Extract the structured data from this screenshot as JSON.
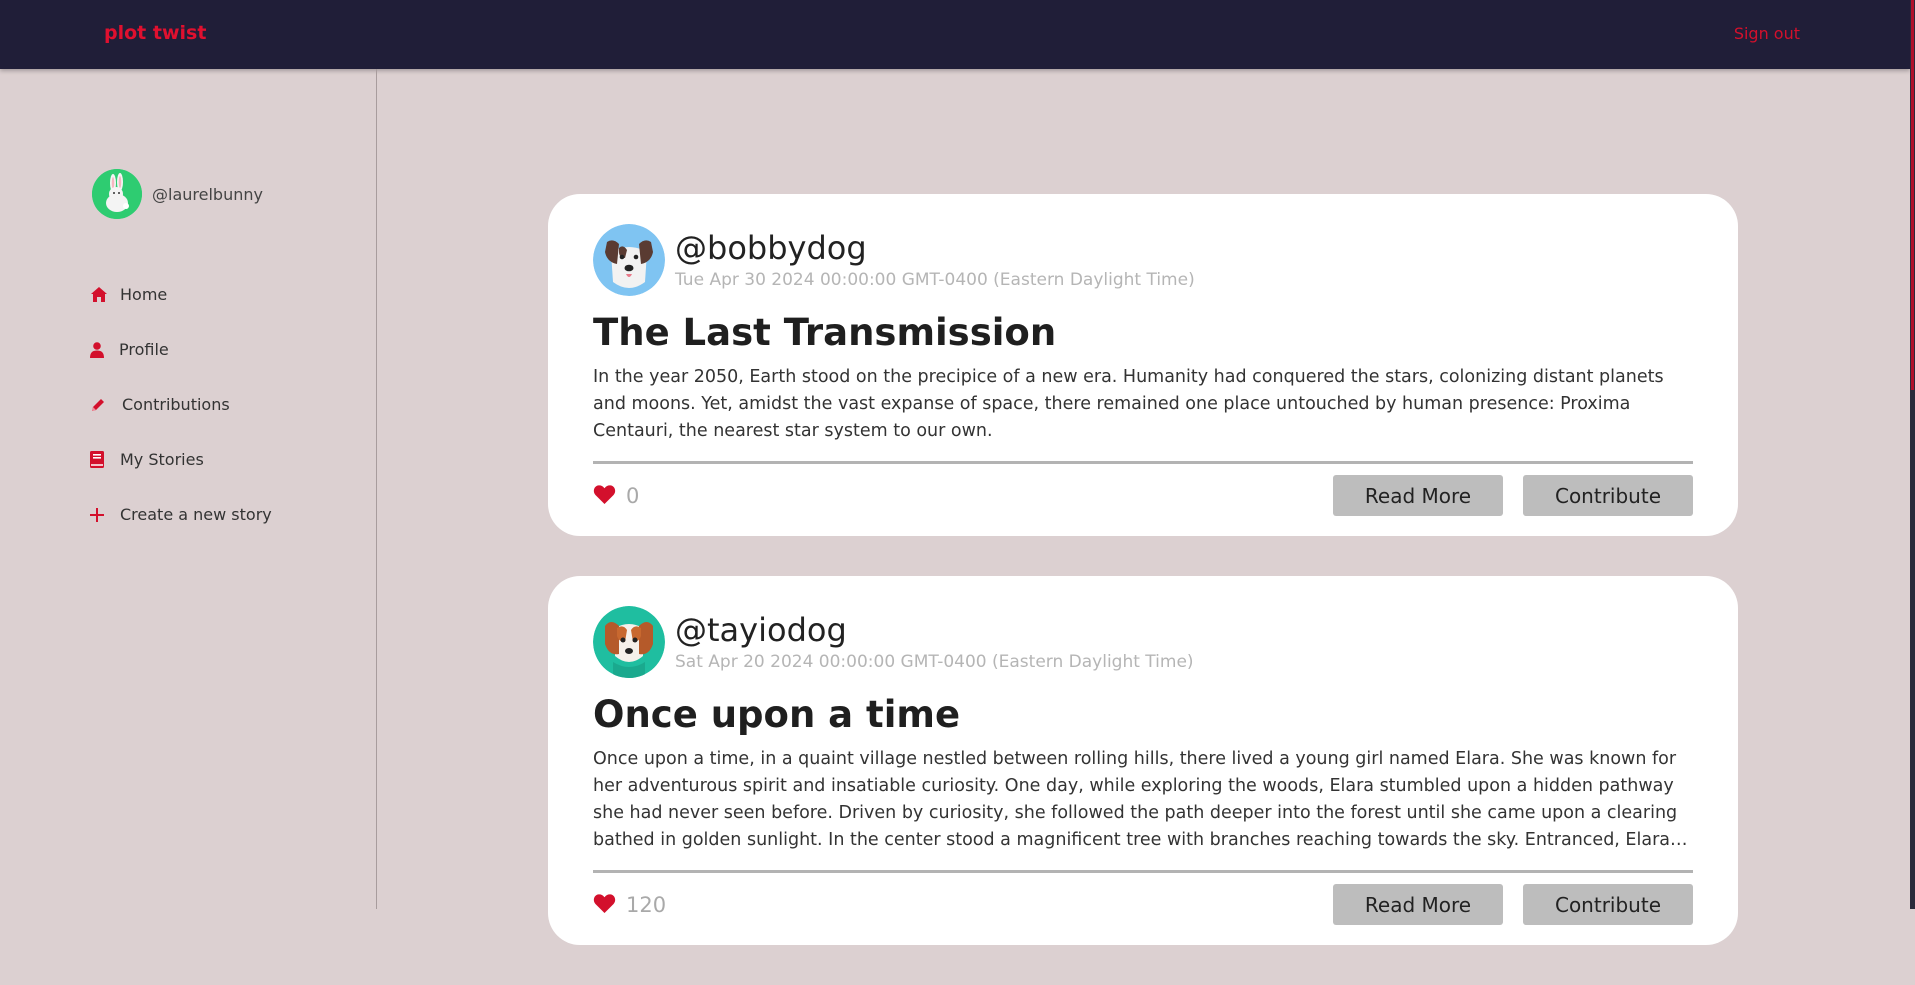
{
  "header": {
    "brand": "plot twist",
    "signout_label": "Sign out"
  },
  "sidebar": {
    "username": "@laurelbunny",
    "items": [
      {
        "label": "Home",
        "icon": "home-icon"
      },
      {
        "label": "Profile",
        "icon": "person-icon"
      },
      {
        "label": "Contributions",
        "icon": "pencil-icon"
      },
      {
        "label": "My Stories",
        "icon": "book-icon"
      },
      {
        "label": "Create a new story",
        "icon": "plus-icon"
      }
    ]
  },
  "stories": [
    {
      "author": "@bobbydog",
      "date": "Tue Apr 30 2024 00:00:00 GMT-0400 (Eastern Daylight Time)",
      "title": "The Last Transmission",
      "excerpt": "In the year 2050, Earth stood on the precipice of a new era. Humanity had conquered the stars, colonizing distant planets and moons. Yet, amidst the vast expanse of space, there remained one place untouched by human presence: Proxima Centauri, the nearest star system to our own.",
      "likes": "0",
      "read_more_label": "Read More",
      "contribute_label": "Contribute"
    },
    {
      "author": "@tayiodog",
      "date": "Sat Apr 20 2024 00:00:00 GMT-0400 (Eastern Daylight Time)",
      "title": "Once upon a time",
      "excerpt": "Once upon a time, in a quaint village nestled between rolling hills, there lived a young girl named Elara. She was known for her adventurous spirit and insatiable curiosity. One day, while exploring the woods, Elara stumbled upon a hidden pathway she had never seen before. Driven by curiosity, she followed the path deeper into the forest until she came upon a clearing bathed in golden sunlight. In the center stood a magnificent tree with branches reaching towards the sky. Entranced, Elara approached the tree",
      "likes": "120",
      "read_more_label": "Read More",
      "contribute_label": "Contribute"
    }
  ],
  "colors": {
    "accent": "#d3102c",
    "header_bg": "#201e38",
    "page_bg": "#dcd0d1"
  }
}
